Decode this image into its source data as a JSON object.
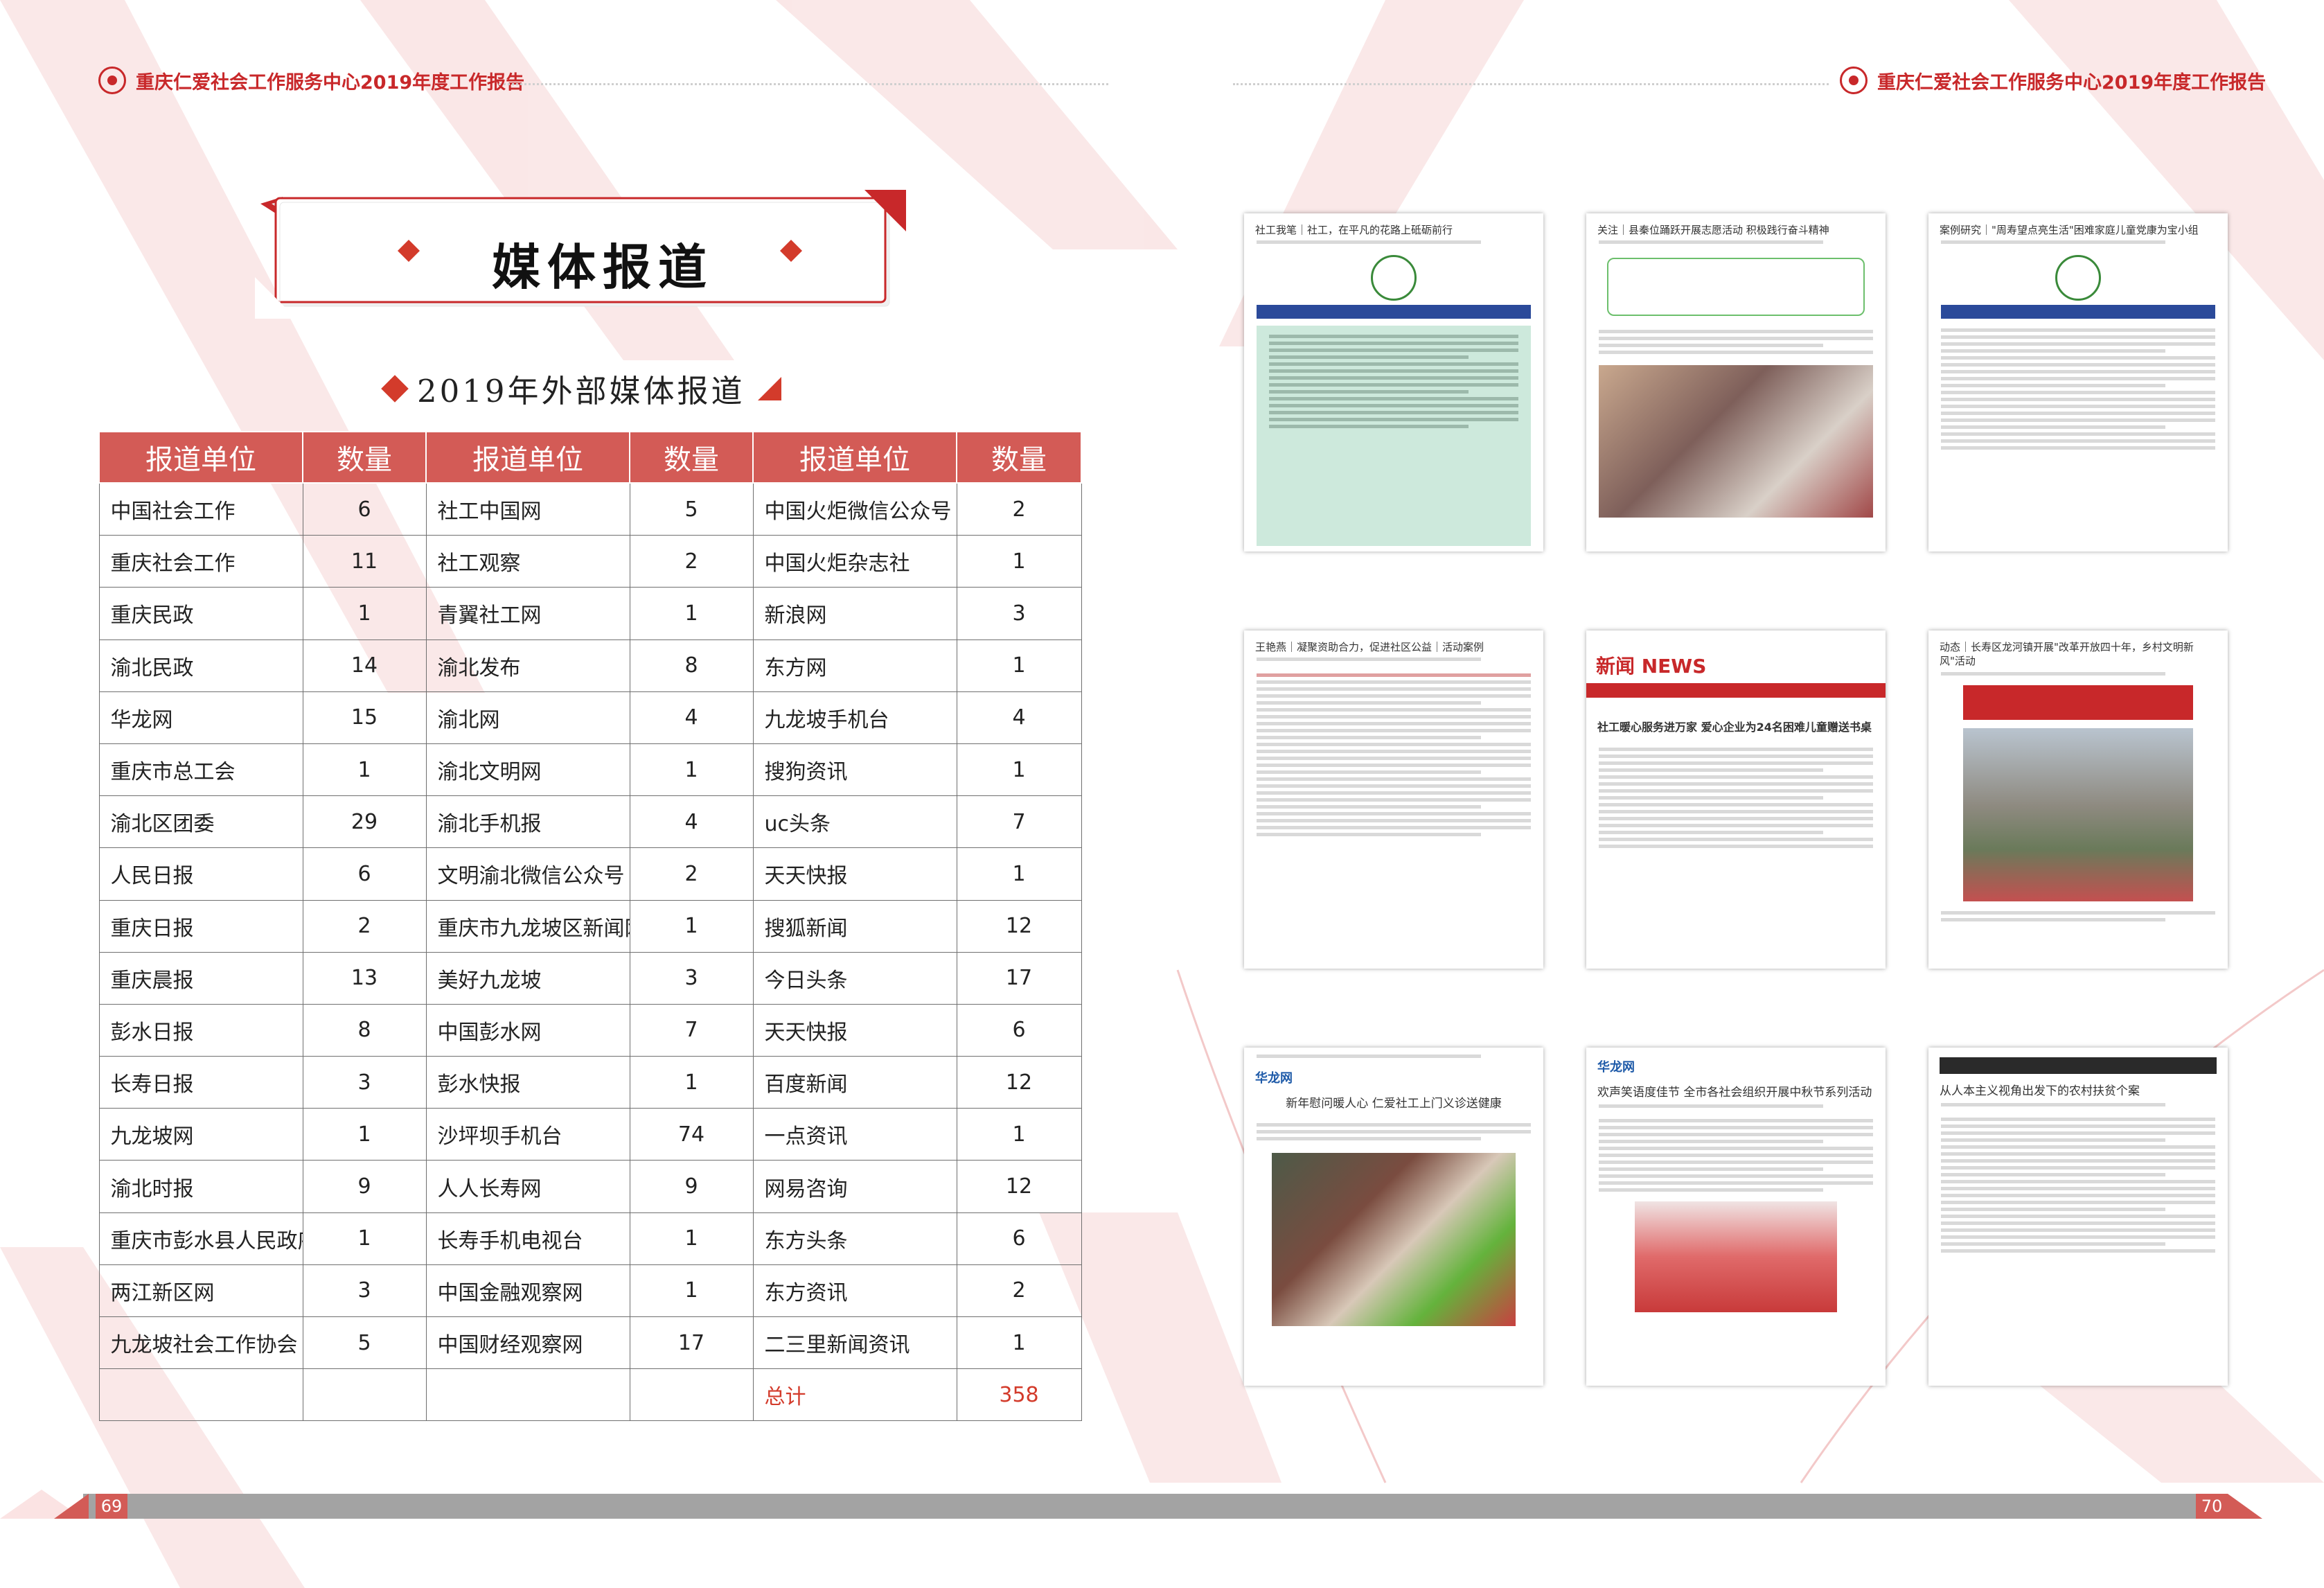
{
  "header": {
    "left_title": "重庆仁爱社会工作服务中心2019年度工作报告",
    "right_title": "重庆仁爱社会工作服务中心2019年度工作报告"
  },
  "section": {
    "title": "媒体报道",
    "subtitle": "2019年外部媒体报道"
  },
  "table": {
    "headers": [
      "报道单位",
      "数量",
      "报道单位",
      "数量",
      "报道单位",
      "数量"
    ],
    "rows": [
      [
        "中国社会工作",
        "6",
        "社工中国网",
        "5",
        "中国火炬微信公众号",
        "2"
      ],
      [
        "重庆社会工作",
        "11",
        "社工观察",
        "2",
        "中国火炬杂志社",
        "1"
      ],
      [
        "重庆民政",
        "1",
        "青翼社工网",
        "1",
        "新浪网",
        "3"
      ],
      [
        "渝北民政",
        "14",
        "渝北发布",
        "8",
        "东方网",
        "1"
      ],
      [
        "华龙网",
        "15",
        "渝北网",
        "4",
        "九龙坡手机台",
        "4"
      ],
      [
        "重庆市总工会",
        "1",
        "渝北文明网",
        "1",
        "搜狗资讯",
        "1"
      ],
      [
        "渝北区团委",
        "29",
        "渝北手机报",
        "4",
        "uc头条",
        "7"
      ],
      [
        "人民日报",
        "6",
        "文明渝北微信公众号",
        "2",
        "天天快报",
        "1"
      ],
      [
        "重庆日报",
        "2",
        "重庆市九龙坡区新闻网",
        "1",
        "搜狐新闻",
        "12"
      ],
      [
        "重庆晨报",
        "13",
        "美好九龙坡",
        "3",
        "今日头条",
        "17"
      ],
      [
        "彭水日报",
        "8",
        "中国彭水网",
        "7",
        "天天快报",
        "6"
      ],
      [
        "长寿日报",
        "3",
        "彭水快报",
        "1",
        "百度新闻",
        "12"
      ],
      [
        "九龙坡网",
        "1",
        "沙坪坝手机台",
        "74",
        "一点资讯",
        "1"
      ],
      [
        "渝北时报",
        "9",
        "人人长寿网",
        "9",
        "网易咨询",
        "12"
      ],
      [
        "重庆市彭水县人民政府网",
        "1",
        "长寿手机电视台",
        "1",
        "东方头条",
        "6"
      ],
      [
        "两江新区网",
        "3",
        "中国金融观察网",
        "1",
        "东方资讯",
        "2"
      ],
      [
        "九龙坡社会工作协会",
        "5",
        "中国财经观察网",
        "17",
        "二三里新闻资讯",
        "1"
      ],
      [
        "",
        "",
        "",
        "",
        "总计",
        "358"
      ]
    ]
  },
  "thumbnails": [
    {
      "headline": "社工我笔｜社工，在平凡的花路上砥砺前行"
    },
    {
      "headline": "关注｜县秦位踊跃开展志愿活动 积极践行奋斗精神"
    },
    {
      "headline": "案例研究｜\"周寿望点亮生活\"困难家庭儿童党康为宝小组"
    },
    {
      "headline": "王艳燕｜凝聚资助合力，促进社区公益｜活动案例"
    },
    {
      "headline": "社工暖心服务进万家 爱心企业为24名困难儿童赠送书桌",
      "masthead": "新闻 NEWS"
    },
    {
      "headline": "动态｜长寿区龙河镇开展\"改革开放四十年，乡村文明新风\"活动"
    },
    {
      "headline": "新年慰问暖人心 仁爱社工上门义诊送健康",
      "site": "华龙网"
    },
    {
      "headline": "欢声笑语度佳节 全市各社会组织开展中秋节系列活动",
      "site": "华龙网"
    },
    {
      "headline": "从人本主义视角出发下的农村扶贫个案"
    }
  ],
  "footer": {
    "page_left": "69",
    "page_right": "70"
  },
  "colors": {
    "accent": "#d35b56",
    "brand_red": "#c8282a"
  }
}
